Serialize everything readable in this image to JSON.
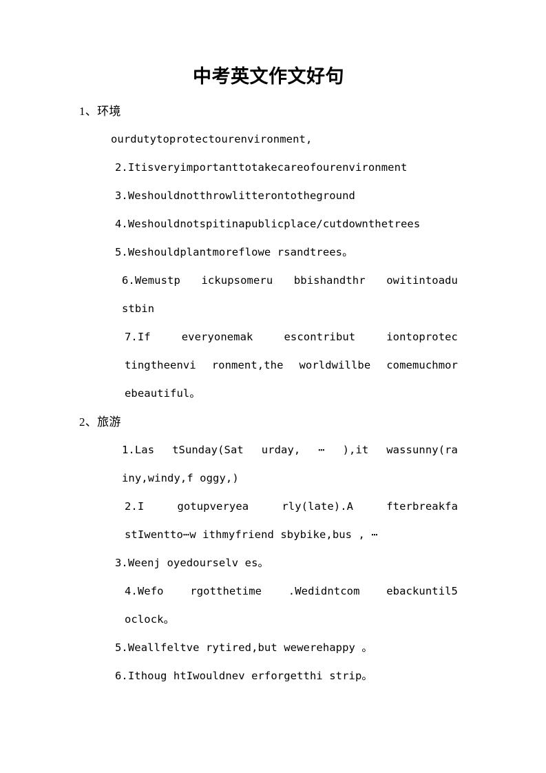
{
  "document": {
    "title": "中考英文作文好句",
    "sections": [
      {
        "heading": "1、环境",
        "items": [
          {
            "id": "env-1",
            "layout": "single",
            "indent": "indent-1",
            "text": "ourdutytoprotectourenvironment,"
          },
          {
            "id": "env-2",
            "layout": "single",
            "indent": "indent-2",
            "text": "2.Itisveryimportanttotakecareofourenvironment"
          },
          {
            "id": "env-3",
            "layout": "single",
            "indent": "indent-2",
            "text": "3.Weshouldnotthrowlitterontotheground"
          },
          {
            "id": "env-4",
            "layout": "single",
            "indent": "indent-2",
            "text": "4.Weshouldnotspitinapublicplace/cutdownthetrees"
          },
          {
            "id": "env-5",
            "layout": "single",
            "indent": "indent-2",
            "text": "5.Weshouldplantmoreflowe rsandtrees。"
          },
          {
            "id": "env-6",
            "layout": "justified",
            "indent": "indent-3",
            "lines": [
              "6.Wemustp ickupsomeru bbishandthr owitintoadu"
            ],
            "last_line": "stbin"
          },
          {
            "id": "env-7",
            "layout": "justified",
            "indent": "indent-4",
            "lines": [
              "7.If everyonemak escontribut iontoprotec",
              "tingtheenvi ronment,the worldwillbe comemuchmor"
            ],
            "last_line": "ebeautiful。"
          }
        ]
      },
      {
        "heading": "2、旅游",
        "items": [
          {
            "id": "travel-1",
            "layout": "justified",
            "indent": "indent-3",
            "lines": [
              "1.Las tSunday(Sat urday, ⋯ ),it wassunny(ra"
            ],
            "last_line": "iny,windy,f oggy,)"
          },
          {
            "id": "travel-2",
            "layout": "justified",
            "indent": "indent-4",
            "lines": [
              "2.I gotupveryea rly(late).A fterbreakfa"
            ],
            "last_line": "stIwentto⋯w ithmyfriend sbybike,bus , ⋯"
          },
          {
            "id": "travel-3",
            "layout": "single",
            "indent": "indent-2",
            "text": "3.Weenj oyedourselv es。"
          },
          {
            "id": "travel-4",
            "layout": "justified",
            "indent": "indent-4",
            "lines": [
              "4.Wefo rgotthetime .Wedidntcom ebackuntil5"
            ],
            "last_line": "oclock。"
          },
          {
            "id": "travel-5",
            "layout": "single",
            "indent": "indent-2",
            "text": "5.Weallfeltve rytired,but wewerehappy 。"
          },
          {
            "id": "travel-6",
            "layout": "single",
            "indent": "indent-2",
            "text": "6.Ithoug htIwouldnev erforgetthi strip。"
          }
        ]
      }
    ]
  }
}
